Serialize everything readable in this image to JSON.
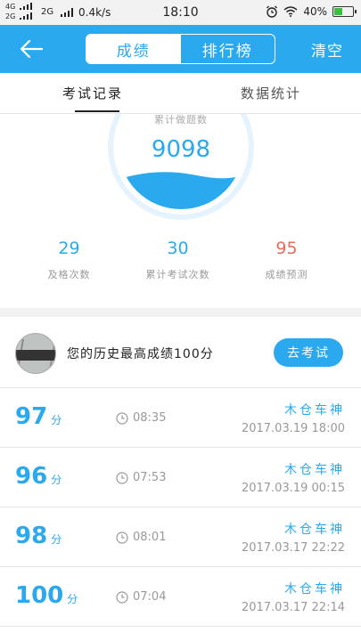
{
  "status_bar": {
    "sim1": "4G",
    "sim2": "2G",
    "net2": "2G",
    "speed": "0.4k/s",
    "time": "18:10",
    "battery": "40%"
  },
  "nav": {
    "tab_active": "成绩",
    "tab_inactive": "排行榜",
    "clear": "清空"
  },
  "subtabs": {
    "records": "考试记录",
    "stats": "数据统计"
  },
  "summary": {
    "circle_label": "累计做题数",
    "circle_value": "9098",
    "items": [
      {
        "value": "29",
        "label": "及格次数",
        "color": "#2aa9ee"
      },
      {
        "value": "30",
        "label": "累计考试次数",
        "color": "#2aa9ee"
      },
      {
        "value": "95",
        "label": "成绩预测",
        "color": "#e56b5d"
      }
    ]
  },
  "best": {
    "text": "您的历史最高成绩100分",
    "button": "去考试"
  },
  "records": [
    {
      "score": "97",
      "unit": "分",
      "duration": "08:35",
      "name": "木仓车神",
      "datetime": "2017.03.19  18:00"
    },
    {
      "score": "96",
      "unit": "分",
      "duration": "07:53",
      "name": "木仓车神",
      "datetime": "2017.03.19  00:15"
    },
    {
      "score": "98",
      "unit": "分",
      "duration": "08:01",
      "name": "木仓车神",
      "datetime": "2017.03.17  22:22"
    },
    {
      "score": "100",
      "unit": "分",
      "duration": "07:04",
      "name": "木仓车神",
      "datetime": "2017.03.17  22:14"
    }
  ],
  "colors": {
    "accent": "#2aa9ee",
    "prediction": "#e56b5d"
  }
}
